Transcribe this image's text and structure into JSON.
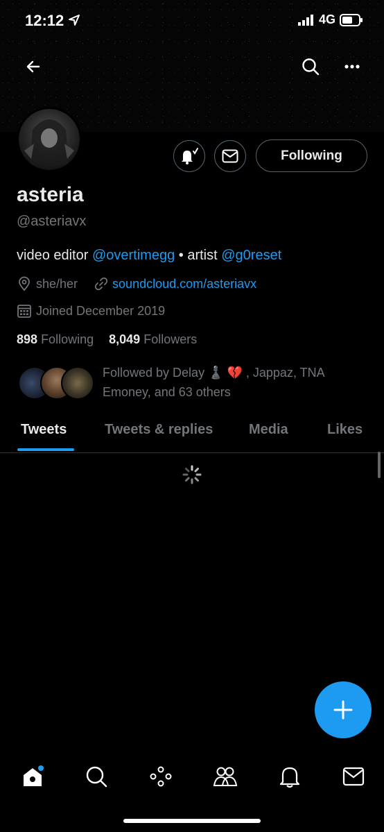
{
  "status_bar": {
    "time": "12:12",
    "network": "4G"
  },
  "profile": {
    "name": "asteria",
    "handle": "@asteriavx",
    "bio": {
      "part1": "video editor ",
      "mention1": "@overtimegg",
      "part2": " • artist ",
      "mention2": "@g0reset"
    },
    "pronouns": "she/her",
    "website": "soundcloud.com/asteriavx",
    "joined": "Joined December 2019",
    "following_count": "898",
    "following_label": "Following",
    "followers_count": "8,049",
    "followers_label": "Followers",
    "followed_by_prefix": "Followed by Delay ♟️ 💔 , Jappaz, TNA Emoney, and 63 others"
  },
  "buttons": {
    "following": "Following"
  },
  "tabs": [
    {
      "label": "Tweets"
    },
    {
      "label": "Tweets & replies"
    },
    {
      "label": "Media"
    },
    {
      "label": "Likes"
    }
  ],
  "icons": {
    "back": "back-arrow-icon",
    "search": "search-icon",
    "more": "more-icon",
    "notify": "bell-check-icon",
    "message": "mail-icon",
    "compose": "plus-icon"
  },
  "colors": {
    "accent": "#1d9bf0",
    "background": "#000000",
    "muted": "#71767b"
  }
}
